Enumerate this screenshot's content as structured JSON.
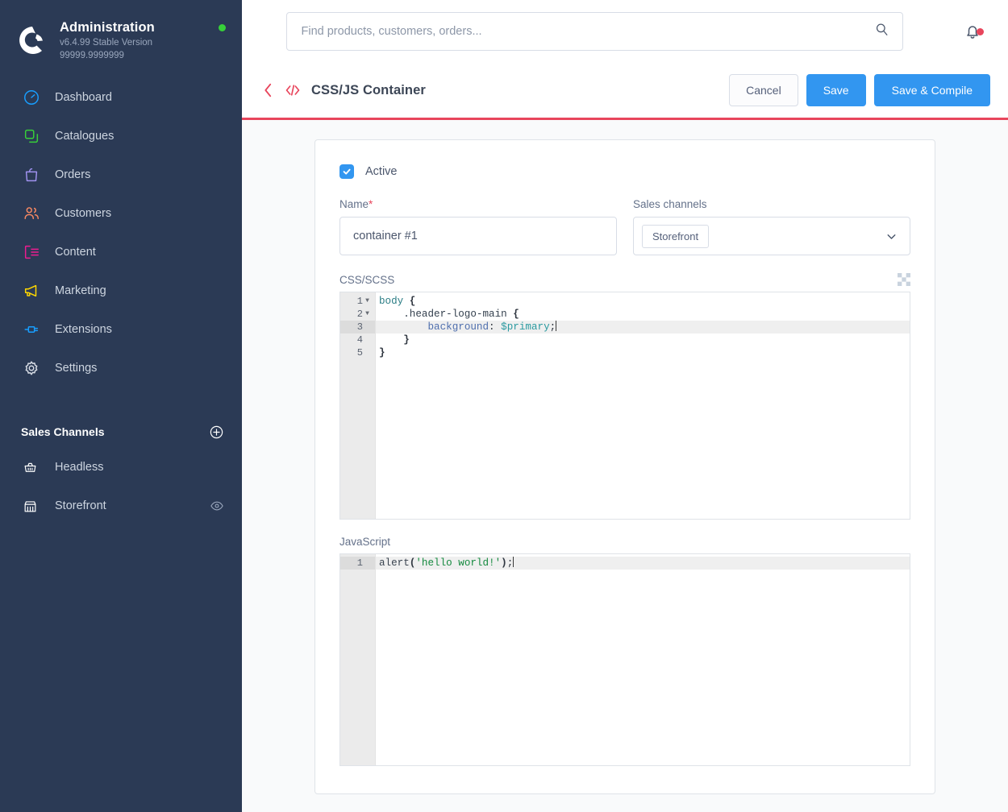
{
  "sidebar": {
    "brand": {
      "title": "Administration",
      "version": "v6.4.99 Stable Version 99999.9999999",
      "logo_icon": "shopware-logo-icon",
      "status_dot_color": "#37d039"
    },
    "nav": [
      {
        "label": "Dashboard",
        "icon": "dashboard-gauge-icon",
        "color": "#189eff"
      },
      {
        "label": "Catalogues",
        "icon": "catalogues-copy-icon",
        "color": "#37d039"
      },
      {
        "label": "Orders",
        "icon": "orders-bag-icon",
        "color": "#a092f0"
      },
      {
        "label": "Customers",
        "icon": "customers-people-icon",
        "color": "#f88962"
      },
      {
        "label": "Content",
        "icon": "content-layout-icon",
        "color": "#ed1c90"
      },
      {
        "label": "Marketing",
        "icon": "marketing-megaphone-icon",
        "color": "#ffd700"
      },
      {
        "label": "Extensions",
        "icon": "extensions-plug-icon",
        "color": "#189eff"
      },
      {
        "label": "Settings",
        "icon": "settings-gear-icon",
        "color": "#d8dde6"
      }
    ],
    "sales_channels": {
      "title": "Sales Channels",
      "add_icon": "plus-circle-icon",
      "items": [
        {
          "label": "Headless",
          "icon": "basket-icon",
          "eye": false
        },
        {
          "label": "Storefront",
          "icon": "storefront-icon",
          "eye": true,
          "eye_icon": "eye-icon"
        }
      ]
    }
  },
  "topbar": {
    "search": {
      "placeholder": "Find products, customers, orders...",
      "value": "",
      "icon": "search-icon"
    },
    "notifications": {
      "icon": "bell-icon",
      "badge": true,
      "badge_color": "#e8455c"
    }
  },
  "pagehead": {
    "back_icon": "chevron-left-icon",
    "type_icon": "code-brackets-icon",
    "accent_color": "#e8455c",
    "title": "CSS/JS Container",
    "actions": {
      "cancel": "Cancel",
      "save": "Save",
      "save_compile": "Save & Compile"
    }
  },
  "form": {
    "active": {
      "label": "Active",
      "checked": true,
      "icon": "checkmark-icon"
    },
    "name": {
      "label": "Name",
      "required_marker": "*",
      "value": "container #1",
      "placeholder": ""
    },
    "sales_channels": {
      "label": "Sales channels",
      "selected": [
        "Storefront"
      ],
      "chevron_icon": "chevron-down-icon"
    },
    "css_editor": {
      "label": "CSS/SCSS",
      "expand_icon": "checkerboard-resize-icon",
      "active_line": 3,
      "lines": [
        {
          "num": 1,
          "fold": true,
          "tokens": [
            {
              "t": "body",
              "c": "t-sel"
            },
            {
              "t": " ",
              "c": "t-punc"
            },
            {
              "t": "{",
              "c": "t-brace"
            }
          ]
        },
        {
          "num": 2,
          "fold": true,
          "tokens": [
            {
              "t": "    ",
              "c": "t-punc"
            },
            {
              "t": ".header-logo-main",
              "c": "t-class"
            },
            {
              "t": " ",
              "c": "t-punc"
            },
            {
              "t": "{",
              "c": "t-brace"
            }
          ]
        },
        {
          "num": 3,
          "fold": false,
          "tokens": [
            {
              "t": "        ",
              "c": "t-punc"
            },
            {
              "t": "background",
              "c": "t-prop"
            },
            {
              "t": ": ",
              "c": "t-punc"
            },
            {
              "t": "$primary",
              "c": "t-var"
            },
            {
              "t": ";",
              "c": "t-punc"
            }
          ]
        },
        {
          "num": 4,
          "fold": false,
          "tokens": [
            {
              "t": "    ",
              "c": "t-punc"
            },
            {
              "t": "}",
              "c": "t-brace"
            }
          ]
        },
        {
          "num": 5,
          "fold": false,
          "tokens": [
            {
              "t": "}",
              "c": "t-brace"
            }
          ]
        }
      ],
      "plain_text": "body {\n    .header-logo-main {\n        background: $primary;\n    }\n}"
    },
    "js_editor": {
      "label": "JavaScript",
      "active_line": 1,
      "lines": [
        {
          "num": 1,
          "fold": false,
          "tokens": [
            {
              "t": "alert",
              "c": "t-fn"
            },
            {
              "t": "(",
              "c": "t-brace"
            },
            {
              "t": "'hello world!'",
              "c": "t-string"
            },
            {
              "t": ")",
              "c": "t-brace"
            },
            {
              "t": ";",
              "c": "t-punc"
            }
          ]
        }
      ],
      "plain_text": "alert('hello world!');"
    }
  },
  "theme": {
    "sidebar_bg": "#2b3a55",
    "primary_blue": "#3296f0",
    "accent_red": "#e8455c",
    "page_bg": "#f9fafb",
    "card_bg": "#ffffff"
  }
}
